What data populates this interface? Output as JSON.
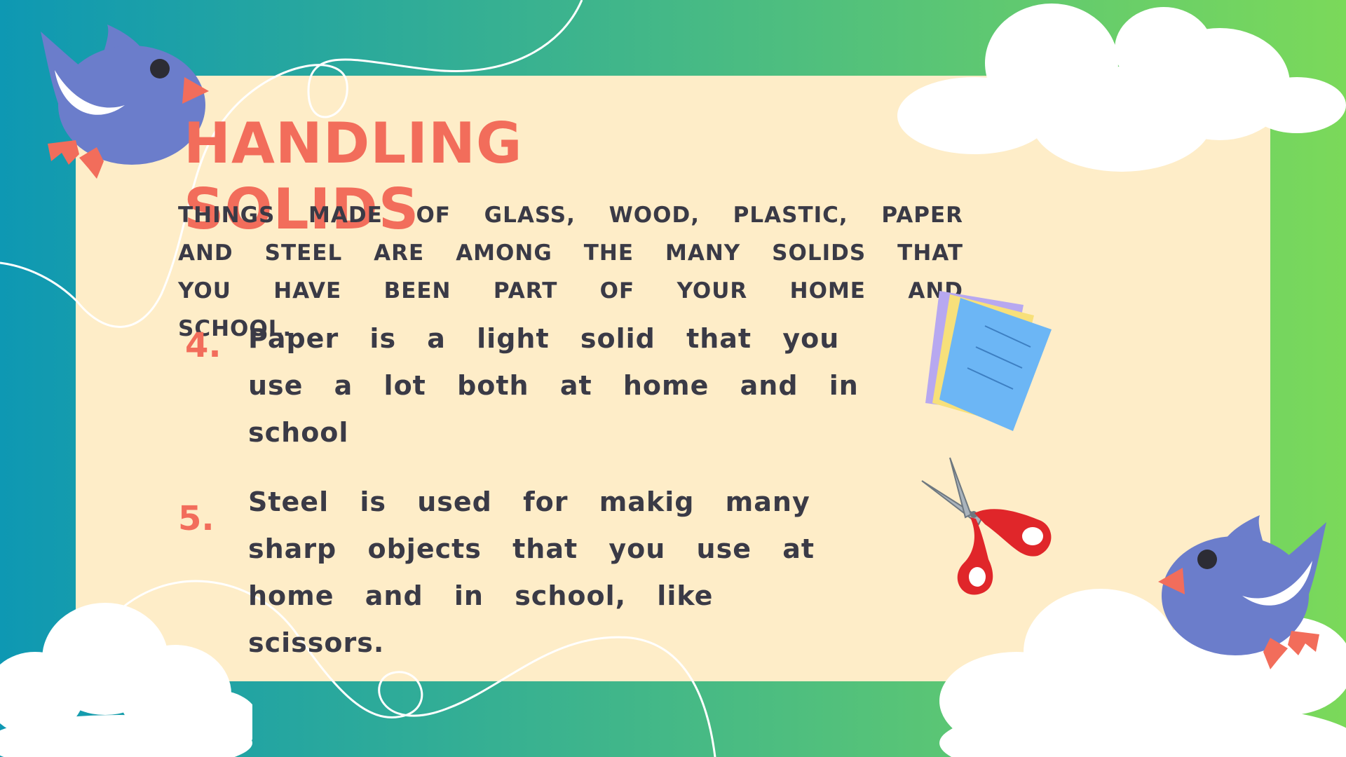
{
  "slide": {
    "title": "HANDLING SOLIDS",
    "intro": "THINGS MADE OF GLASS, WOOD, PLASTIC, PAPER AND STEEL ARE AMONG THE MANY SOLIDS THAT YOU HAVE BEEN PART OF YOUR HOME AND SCHOOL.",
    "items": [
      {
        "number": "4.",
        "text": "Paper is a light solid that you use a lot both at home and in school",
        "icon": "paper-sheets-icon"
      },
      {
        "number": "5.",
        "text": "Steel is used for makig many sharp objects that you use at home and in school, like scissors.",
        "icon": "scissors-icon"
      }
    ]
  },
  "colors": {
    "gradient_left": "#0E98B3",
    "gradient_right": "#7BD95A",
    "panel": "#FEEDC8",
    "accent": "#F26D5B",
    "text": "#3A3A46",
    "bird": "#6B7DCB"
  },
  "decorations": [
    "bird-icon",
    "bird-icon",
    "cloud-icon",
    "cloud-icon",
    "cloud-icon"
  ]
}
